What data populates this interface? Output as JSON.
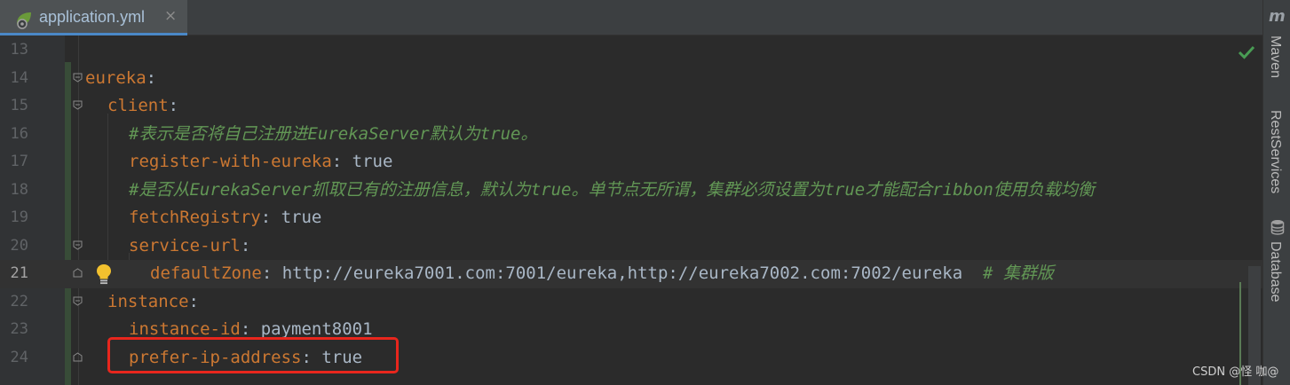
{
  "tab": {
    "label": "application.yml",
    "close": "×"
  },
  "right_sidebar": {
    "m_glyph": "m",
    "maven": "Maven",
    "rest": "RestServices",
    "database": "Database"
  },
  "watermark": "CSDN @怪 咖@",
  "colors": {
    "key": "#cc7832",
    "comment": "#629755",
    "text": "#a9b7c6",
    "highlight": "#e8261d"
  },
  "lines": [
    {
      "num": "13"
    },
    {
      "num": "14",
      "key": "eureka",
      "colon": ":"
    },
    {
      "num": "15",
      "key": "client",
      "colon": ":"
    },
    {
      "num": "16",
      "comment": "#表示是否将自己注册进EurekaServer默认为true。"
    },
    {
      "num": "17",
      "key": "register-with-eureka",
      "colon": ":",
      "value": " true"
    },
    {
      "num": "18",
      "comment": "#是否从EurekaServer抓取已有的注册信息，默认为true。单节点无所谓，集群必须设置为true才能配合ribbon使用负载均衡"
    },
    {
      "num": "19",
      "key": "fetchRegistry",
      "colon": ":",
      "value": " true"
    },
    {
      "num": "20",
      "key": "service-url",
      "colon": ":"
    },
    {
      "num": "21",
      "key": "defaultZone",
      "colon": ":",
      "value": " http://eureka7001.com:7001/eureka,http://eureka7002.com:7002/eureka  ",
      "comment": "# 集群版"
    },
    {
      "num": "22",
      "key": "instance",
      "colon": ":"
    },
    {
      "num": "23",
      "key": "instance-id",
      "colon": ":",
      "value": " payment8001"
    },
    {
      "num": "24",
      "key": "prefer-ip-address",
      "colon": ":",
      "value": " true"
    }
  ]
}
